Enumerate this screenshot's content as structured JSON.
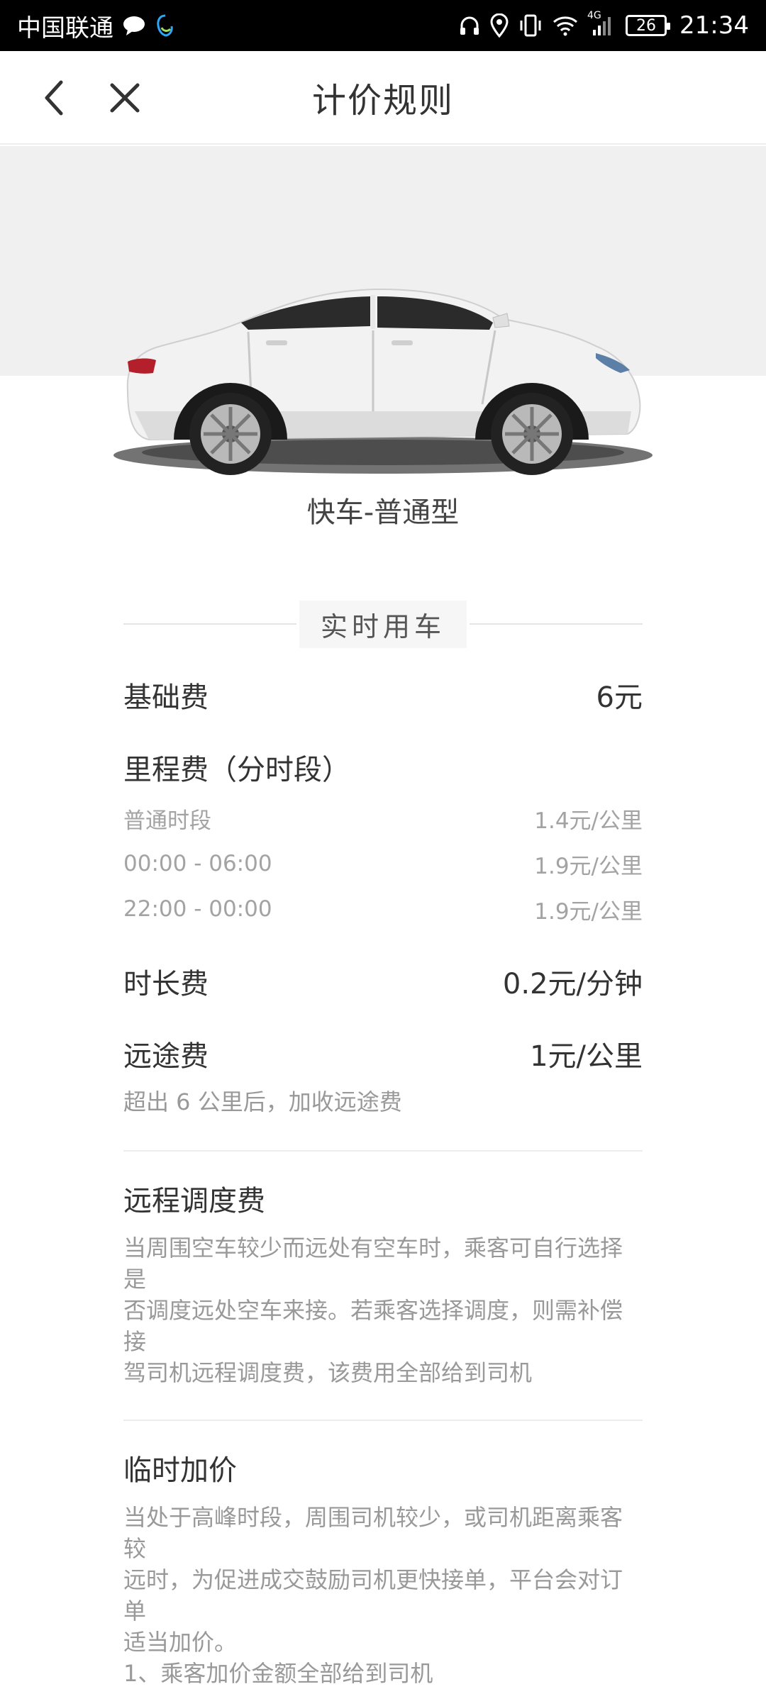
{
  "status_bar": {
    "carrier": "中国联通",
    "battery": "26",
    "network": "4G",
    "time": "21:34"
  },
  "nav": {
    "title": "计价规则"
  },
  "hero": {
    "car_name": "快车-普通型"
  },
  "section": {
    "label": "实时用车"
  },
  "fees": {
    "base": {
      "label": "基础费",
      "value": "6元"
    },
    "mileage": {
      "label": "里程费（分时段）",
      "periods": [
        {
          "label": "普通时段",
          "value": "1.4元/公里"
        },
        {
          "label": "00:00 - 06:00",
          "value": "1.9元/公里"
        },
        {
          "label": "22:00 - 00:00",
          "value": "1.9元/公里"
        }
      ]
    },
    "duration": {
      "label": "时长费",
      "value": "0.2元/分钟"
    },
    "long_distance": {
      "label": "远途费",
      "value": "1元/公里",
      "note": "超出 6 公里后，加收远途费"
    }
  },
  "remote_dispatch": {
    "title": "远程调度费",
    "lines": [
      "当周围空车较少而远处有空车时，乘客可自行选择是",
      "否调度远处空车来接。若乘客选择调度，则需补偿接",
      "驾司机远程调度费，该费用全部给到司机"
    ]
  },
  "surge": {
    "title": "临时加价",
    "lines": [
      "当处于高峰时段，周围司机较少，或司机距离乘客较",
      "远时，为促进成交鼓励司机更快接单，平台会对订单",
      "适当加价。",
      "1、乘客加价金额全部给到司机"
    ]
  }
}
